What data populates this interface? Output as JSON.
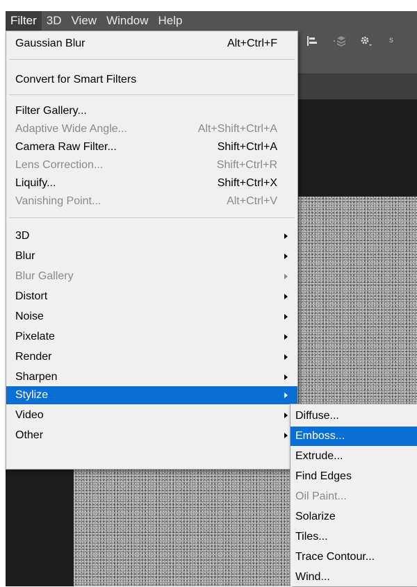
{
  "menubar": {
    "items": [
      {
        "label": "Filter",
        "active": true
      },
      {
        "label": "3D",
        "active": false
      },
      {
        "label": "View",
        "active": false
      },
      {
        "label": "Window",
        "active": false
      },
      {
        "label": "Help",
        "active": false
      }
    ]
  },
  "options_bar": {
    "icons": [
      "align-icon",
      "layers-3d-icon",
      "gear-icon"
    ],
    "trailing_text": "s"
  },
  "filter_menu": {
    "items": [
      {
        "label": "Gaussian Blur",
        "shortcut": "Alt+Ctrl+F",
        "enabled": true
      },
      {
        "label": "Convert for Smart Filters",
        "shortcut": "",
        "enabled": true
      },
      {
        "label": "Filter Gallery...",
        "shortcut": "",
        "enabled": true
      },
      {
        "label": "Adaptive Wide Angle...",
        "shortcut": "Alt+Shift+Ctrl+A",
        "enabled": false
      },
      {
        "label": "Camera Raw Filter...",
        "shortcut": "Shift+Ctrl+A",
        "enabled": true
      },
      {
        "label": "Lens Correction...",
        "shortcut": "Shift+Ctrl+R",
        "enabled": false
      },
      {
        "label": "Liquify...",
        "shortcut": "Shift+Ctrl+X",
        "enabled": true
      },
      {
        "label": "Vanishing Point...",
        "shortcut": "Alt+Ctrl+V",
        "enabled": false
      },
      {
        "label": "3D",
        "submenu": true,
        "enabled": true
      },
      {
        "label": "Blur",
        "submenu": true,
        "enabled": true
      },
      {
        "label": "Blur Gallery",
        "submenu": true,
        "enabled": false
      },
      {
        "label": "Distort",
        "submenu": true,
        "enabled": true
      },
      {
        "label": "Noise",
        "submenu": true,
        "enabled": true
      },
      {
        "label": "Pixelate",
        "submenu": true,
        "enabled": true
      },
      {
        "label": "Render",
        "submenu": true,
        "enabled": true
      },
      {
        "label": "Sharpen",
        "submenu": true,
        "enabled": true
      },
      {
        "label": "Stylize",
        "submenu": true,
        "enabled": true,
        "highlighted": true
      },
      {
        "label": "Video",
        "submenu": true,
        "enabled": true
      },
      {
        "label": "Other",
        "submenu": true,
        "enabled": true
      }
    ]
  },
  "stylize_submenu": {
    "items": [
      {
        "label": "Diffuse...",
        "enabled": true
      },
      {
        "label": "Emboss...",
        "enabled": true,
        "highlighted": true
      },
      {
        "label": "Extrude...",
        "enabled": true
      },
      {
        "label": "Find Edges",
        "enabled": true
      },
      {
        "label": "Oil Paint...",
        "enabled": false
      },
      {
        "label": "Solarize",
        "enabled": true
      },
      {
        "label": "Tiles...",
        "enabled": true
      },
      {
        "label": "Trace Contour...",
        "enabled": true
      },
      {
        "label": "Wind...",
        "enabled": true
      }
    ]
  },
  "colors": {
    "highlight": "#0a6fd4",
    "menu_background": "#f0f0f0",
    "disabled_text": "#8a8a8a",
    "menubar_background": "#535353",
    "workspace_background": "#1d1d1e"
  }
}
